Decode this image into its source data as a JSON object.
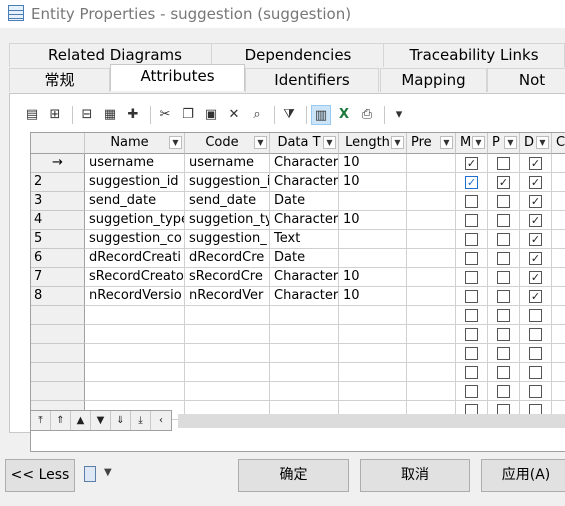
{
  "window": {
    "title": "Entity Properties - suggestion (suggestion)"
  },
  "tabs_back": [
    "Related Diagrams",
    "Dependencies",
    "Traceability Links"
  ],
  "tabs_front": [
    "常规",
    "Attributes",
    "Identifiers",
    "Mapping",
    "Not"
  ],
  "active_tab": "Attributes",
  "toolbar": {
    "icons": [
      "properties-icon",
      "insert-row-icon",
      "add-row-icon",
      "add-attribute-icon",
      "new-item-icon",
      "cut-icon",
      "copy-icon",
      "paste-icon",
      "delete-icon",
      "find-icon",
      "filter-icon",
      "customize-columns-icon",
      "excel-export-icon",
      "print-icon",
      "dropdown-icon"
    ]
  },
  "columns": [
    "Name",
    "Code",
    "Data T",
    "Length",
    "Pre",
    "M",
    "P",
    "D",
    "Co"
  ],
  "rows": [
    {
      "marker": "→",
      "name": "username",
      "code": "username",
      "type": "Character",
      "length": "10",
      "m": true,
      "m_blue": false,
      "p": false,
      "d": true
    },
    {
      "marker": "2",
      "name": "suggestion_id",
      "code": "suggestion_i",
      "type": "Character",
      "length": "10",
      "m": true,
      "m_blue": true,
      "p": true,
      "d": true
    },
    {
      "marker": "3",
      "name": "send_date",
      "code": "send_date",
      "type": "Date",
      "length": "",
      "m": false,
      "m_blue": false,
      "p": false,
      "d": true
    },
    {
      "marker": "4",
      "name": "suggetion_type",
      "code": "suggetion_ty",
      "type": "Character",
      "length": "10",
      "m": false,
      "m_blue": false,
      "p": false,
      "d": true
    },
    {
      "marker": "5",
      "name": "suggestion_co",
      "code": "suggestion_",
      "type": "Text",
      "length": "",
      "m": false,
      "m_blue": false,
      "p": false,
      "d": true
    },
    {
      "marker": "6",
      "name": "dRecordCreati",
      "code": "dRecordCre",
      "type": "Date",
      "length": "",
      "m": false,
      "m_blue": false,
      "p": false,
      "d": true
    },
    {
      "marker": "7",
      "name": "sRecordCreato",
      "code": "sRecordCre",
      "type": "Character",
      "length": "10",
      "m": false,
      "m_blue": false,
      "p": false,
      "d": true
    },
    {
      "marker": "8",
      "name": "nRecordVersio",
      "code": "nRecordVer",
      "type": "Character",
      "length": "10",
      "m": false,
      "m_blue": false,
      "p": false,
      "d": true
    }
  ],
  "empty_rows": 6,
  "buttons": {
    "less": "<< Less",
    "ok": "确定",
    "cancel": "取消",
    "apply": "应用(A)"
  }
}
